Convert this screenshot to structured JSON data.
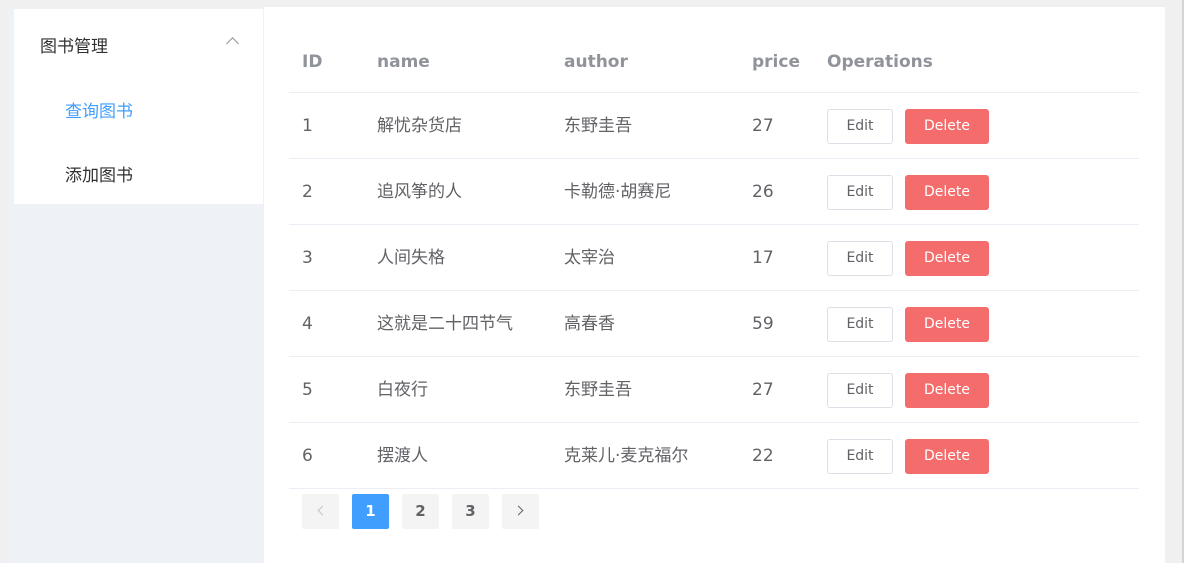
{
  "sidebar": {
    "group_title": "图书管理",
    "items": [
      {
        "label": "查询图书",
        "active": true
      },
      {
        "label": "添加图书",
        "active": false
      }
    ]
  },
  "table": {
    "headers": {
      "id": "ID",
      "name": "name",
      "author": "author",
      "price": "price",
      "ops": "Operations"
    },
    "rows": [
      {
        "id": "1",
        "name": "解忧杂货店",
        "author": "东野圭吾",
        "price": "27"
      },
      {
        "id": "2",
        "name": "追风筝的人",
        "author": "卡勒德·胡赛尼",
        "price": "26"
      },
      {
        "id": "3",
        "name": "人间失格",
        "author": "太宰治",
        "price": "17"
      },
      {
        "id": "4",
        "name": "这就是二十四节气",
        "author": "高春香",
        "price": "59"
      },
      {
        "id": "5",
        "name": "白夜行",
        "author": "东野圭吾",
        "price": "27"
      },
      {
        "id": "6",
        "name": "摆渡人",
        "author": "克莱儿·麦克福尔",
        "price": "22"
      }
    ],
    "edit_label": "Edit",
    "delete_label": "Delete"
  },
  "pagination": {
    "pages": [
      "1",
      "2",
      "3"
    ],
    "current": "1"
  },
  "colors": {
    "accent": "#409eff",
    "danger": "#f56c6c"
  }
}
